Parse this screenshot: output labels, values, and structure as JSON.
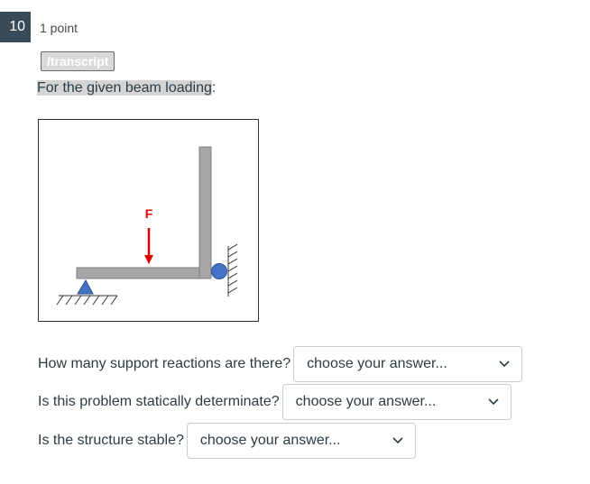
{
  "question": {
    "number": "10",
    "points": "1 point",
    "transcript_label": "/transcript",
    "intro_highlighted": "For the given beam loading",
    "intro_suffix": ":"
  },
  "figure": {
    "force_label": "F",
    "colors": {
      "beam": "#a6a6a6",
      "beam_edge": "#7f7f7f",
      "pin_support": "#4472c4",
      "roller_support": "#4472c4",
      "force_arrow": "#e00000"
    }
  },
  "questions": [
    {
      "prompt": "How many support reactions are there?",
      "selected": "choose your answer..."
    },
    {
      "prompt": "Is this problem statically determinate?",
      "selected": "choose your answer..."
    },
    {
      "prompt": "Is the structure stable?",
      "selected": "choose your answer..."
    }
  ],
  "icons": {
    "dropdown": "chevron-down-icon"
  }
}
